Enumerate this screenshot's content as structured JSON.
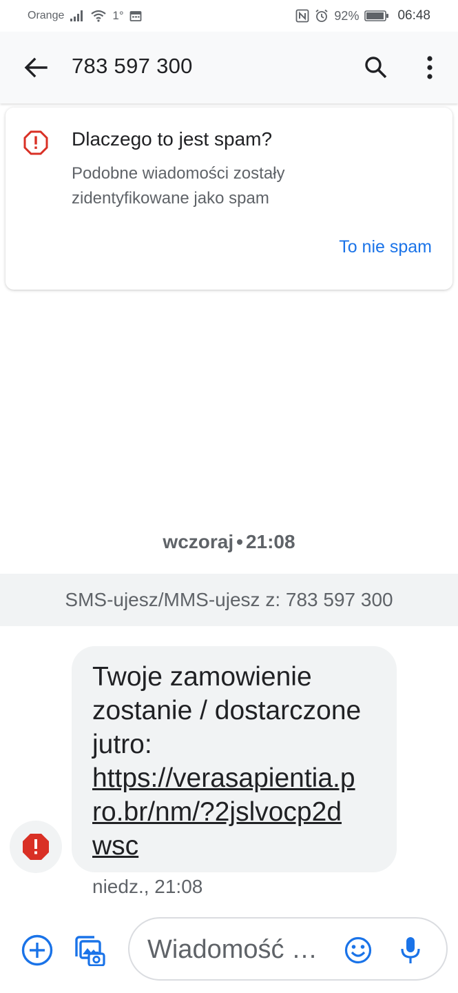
{
  "status_bar": {
    "carrier": "Orange",
    "temperature": "1°",
    "battery_percent": "92%",
    "time": "06:48",
    "icons": [
      "signal-icon",
      "wifi-icon",
      "calendar-icon",
      "nfc-icon",
      "alarm-icon",
      "battery-icon"
    ]
  },
  "app_bar": {
    "title": "783 597 300",
    "icons": [
      "back-arrow-icon",
      "search-icon",
      "more-vert-icon"
    ]
  },
  "spam_card": {
    "title": "Dlaczego to jest spam?",
    "description": "Podobne wiadomości zostały zidentyfikowane jako spam",
    "action_label": "To nie spam",
    "icon": "spam-warning-icon"
  },
  "conversation": {
    "date_label": "wczoraj",
    "date_time": "21:08",
    "sim_banner": "SMS-ujesz/MMS-ujesz z: 783 597 300",
    "message": {
      "text": "Twoje zamowienie zostanie / dostarczone  jutro:",
      "link": "https://verasapientia.pro.br/nm/?2jslvocp2dwsc",
      "timestamp": "niedz., 21:08",
      "avatar_icon": "spam-avatar-icon"
    }
  },
  "compose": {
    "placeholder": "Wiadomość …",
    "icons": [
      "add-icon",
      "gallery-icon",
      "emoji-icon",
      "mic-icon"
    ]
  },
  "colors": {
    "accent_blue": "#1a73e8",
    "spam_red": "#d93025",
    "app_bar_bg": "#f8f9fa",
    "bubble_bg": "#f1f3f4"
  }
}
